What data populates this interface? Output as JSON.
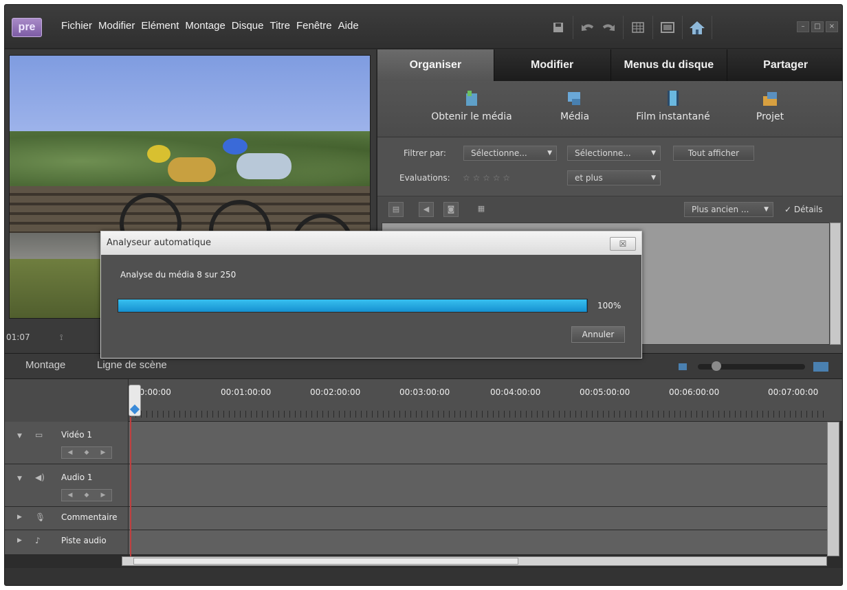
{
  "app": {
    "logo_text": "pre"
  },
  "menu": [
    "Fichier",
    "Modifier",
    "Elément",
    "Montage",
    "Disque",
    "Titre",
    "Fenêtre",
    "Aide"
  ],
  "monitor": {
    "timecode": "01:07"
  },
  "tasks": {
    "tabs": [
      "Organiser",
      "Modifier",
      "Menus du disque",
      "Partager"
    ],
    "active_tab": "Organiser",
    "tools": [
      "Obtenir le média",
      "Média",
      "Film instantané",
      "Projet"
    ]
  },
  "filters": {
    "filter_label": "Filtrer par:",
    "filter1": "Sélectionne...",
    "filter2": "Sélectionne...",
    "show_all": "Tout afficher",
    "ratings_label": "Evaluations:",
    "ratings_stars": "☆ ☆ ☆ ☆ ☆",
    "rating_mode": "et plus",
    "sort": "Plus ancien ...",
    "details": "Détails"
  },
  "timeline": {
    "tabs": [
      "Montage",
      "Ligne de scène"
    ],
    "timecodes": [
      "00:00:00",
      "00:01:00:00",
      "00:02:00:00",
      "00:03:00:00",
      "00:04:00:00",
      "00:05:00:00",
      "00:06:00:00",
      "00:07:00:00"
    ],
    "tracks": [
      "Vidéo 1",
      "Audio 1",
      "Commentaire",
      "Piste audio"
    ]
  },
  "dialog": {
    "title": "Analyseur automatique",
    "message": "Analyse du média  8 sur 250",
    "progress": 1.0,
    "percent_text": "100%",
    "cancel": "Annuler"
  },
  "colors": {
    "progress": "#1ea6e0",
    "accent_tab": "#5e5e5e"
  }
}
